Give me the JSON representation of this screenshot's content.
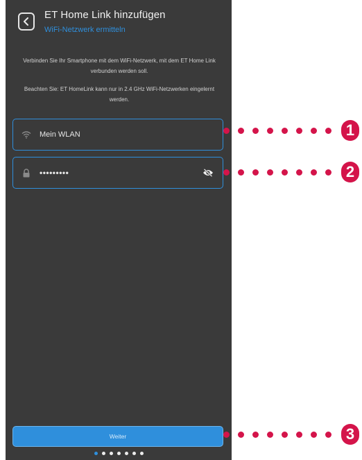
{
  "header": {
    "title": "ET Home Link hinzufügen",
    "subtitle": "WiFi-Netzwerk ermitteln"
  },
  "description": {
    "line1": "Verbinden Sie Ihr Smartphone mit dem WiFi-Netzwerk, mit dem ET Home Link verbunden werden soll.",
    "line2": "Beachten Sie: ET HomeLink kann nur in 2.4 GHz WiFi-Netzwerken eingelernt werden."
  },
  "form": {
    "ssid_value": "Mein WLAN",
    "password_value": "•••••••••",
    "ssid_icon": "wifi-icon",
    "password_icon": "lock-icon",
    "visibility_icon": "eye-off-icon"
  },
  "footer": {
    "next_label": "Weiter"
  },
  "pager": {
    "total": 7,
    "active": 1
  },
  "callouts": [
    "1",
    "2",
    "3"
  ],
  "colors": {
    "background": "#3a3a3a",
    "accent": "#2f8fdc",
    "callout": "#d4144a"
  }
}
